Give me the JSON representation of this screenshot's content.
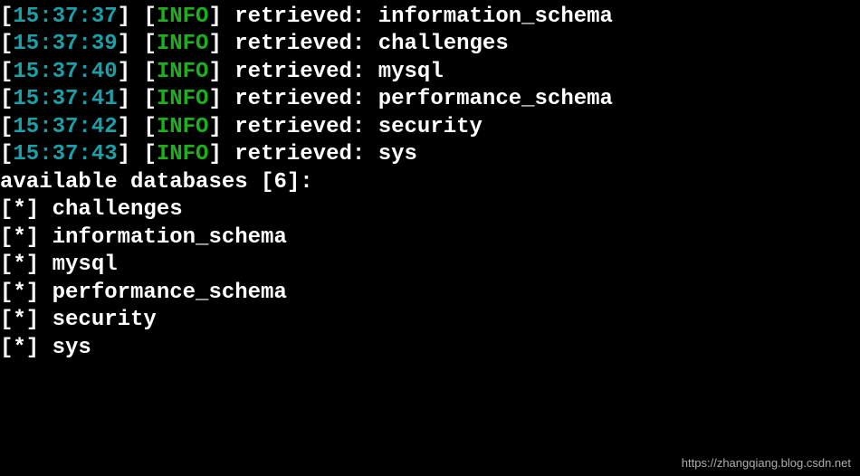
{
  "logs": [
    {
      "timestamp": "15:37:37",
      "level": "INFO",
      "action": "retrieved:",
      "value": "information_schema"
    },
    {
      "timestamp": "15:37:39",
      "level": "INFO",
      "action": "retrieved:",
      "value": "challenges"
    },
    {
      "timestamp": "15:37:40",
      "level": "INFO",
      "action": "retrieved:",
      "value": "mysql"
    },
    {
      "timestamp": "15:37:41",
      "level": "INFO",
      "action": "retrieved:",
      "value": "performance_schema"
    },
    {
      "timestamp": "15:37:42",
      "level": "INFO",
      "action": "retrieved:",
      "value": "security"
    },
    {
      "timestamp": "15:37:43",
      "level": "INFO",
      "action": "retrieved:",
      "value": "sys"
    }
  ],
  "summary_header": "available databases [6]:",
  "databases": [
    "challenges",
    "information_schema",
    "mysql",
    "performance_schema",
    "security",
    "sys"
  ],
  "watermark": "https://zhangqiang.blog.csdn.net"
}
